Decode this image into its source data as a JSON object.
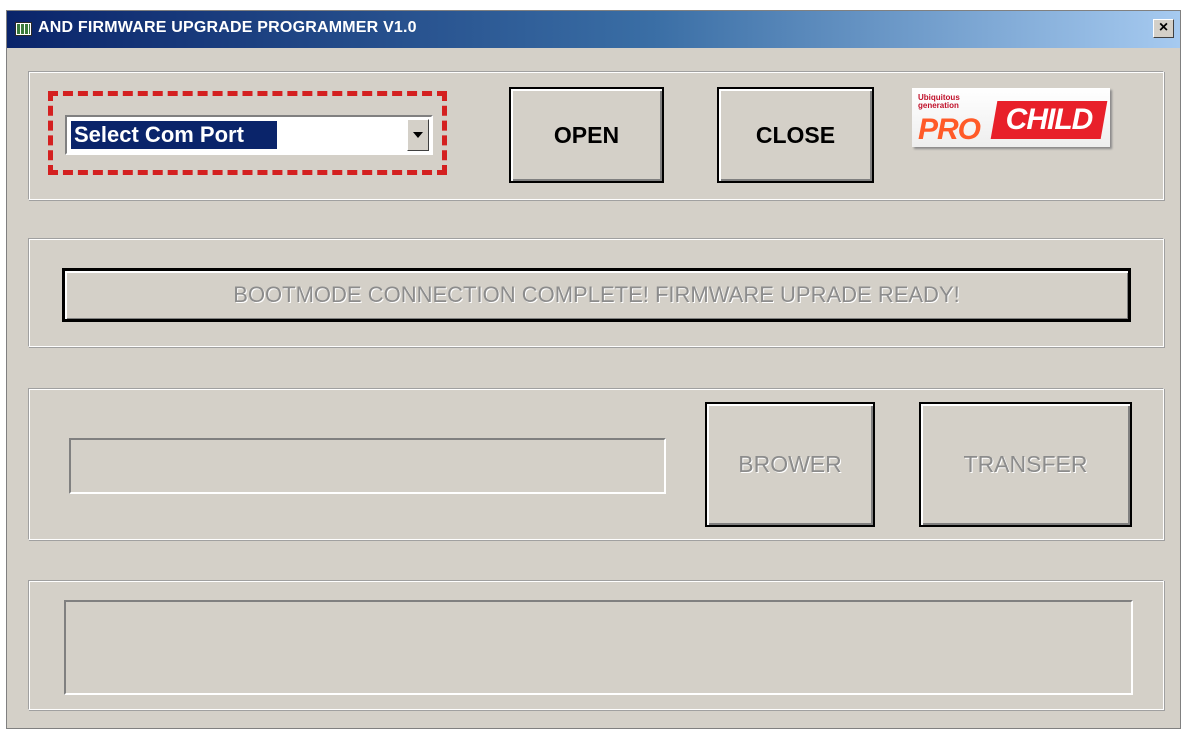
{
  "window": {
    "title": "AND FIRMWARE UPGRADE PROGRAMMER V1.0",
    "close_label": "×"
  },
  "port": {
    "selected": "Select Com Port"
  },
  "buttons": {
    "open": "OPEN",
    "close": "CLOSE",
    "brower": "BROWER",
    "transfer": "TRANSFER"
  },
  "logo": {
    "tagline": "Ubiquitous\ngeneration",
    "pro": "PRO",
    "child": "CHILD"
  },
  "status": {
    "message": "BOOTMODE CONNECTION COMPLETE! FIRMWARE UPRADE READY!"
  },
  "file": {
    "path": ""
  },
  "log": {
    "text": ""
  },
  "colors": {
    "highlight": "#d42020",
    "titlebar_start": "#0a246a",
    "titlebar_end": "#a6caf0",
    "dialog_bg": "#d4d0c8"
  }
}
